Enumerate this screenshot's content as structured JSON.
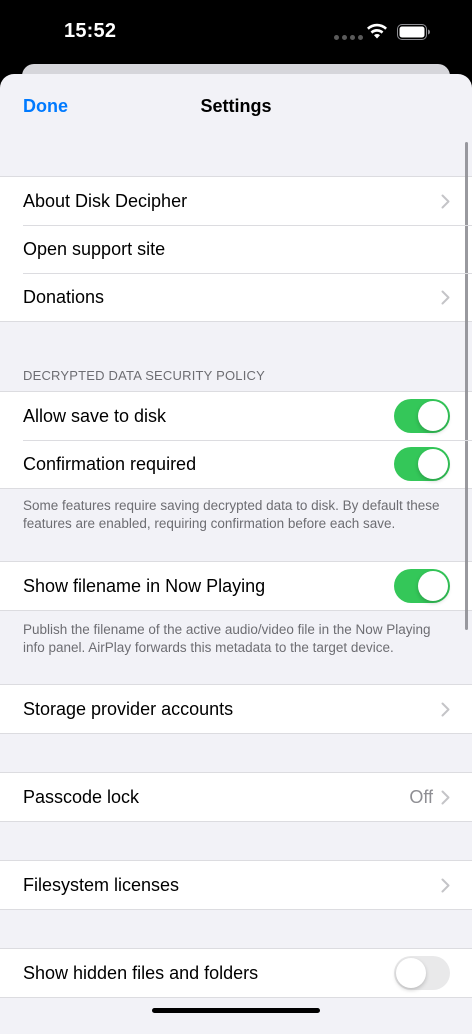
{
  "status_bar": {
    "time": "15:52"
  },
  "nav": {
    "done_label": "Done",
    "title": "Settings"
  },
  "group_info": {
    "about": "About Disk Decipher",
    "support": "Open support site",
    "donations": "Donations"
  },
  "security": {
    "header": "DECRYPTED DATA SECURITY POLICY",
    "allow_save": "Allow save to disk",
    "allow_save_on": true,
    "confirmation": "Confirmation required",
    "confirmation_on": true,
    "footer": "Some features require saving decrypted data to disk. By default these features are enabled, requiring confirmation before each save."
  },
  "now_playing": {
    "label": "Show filename in Now Playing",
    "on": true,
    "footer": "Publish the filename of the active audio/video file in the Now Playing info panel. AirPlay forwards this metadata to the target device."
  },
  "storage": {
    "label": "Storage provider accounts"
  },
  "passcode": {
    "label": "Passcode lock",
    "value": "Off"
  },
  "licenses": {
    "label": "Filesystem licenses"
  },
  "hidden_files": {
    "label": "Show hidden files and folders",
    "on": false
  },
  "colors": {
    "accent": "#007aff",
    "toggle_on": "#34c759",
    "background": "#f2f2f7"
  }
}
